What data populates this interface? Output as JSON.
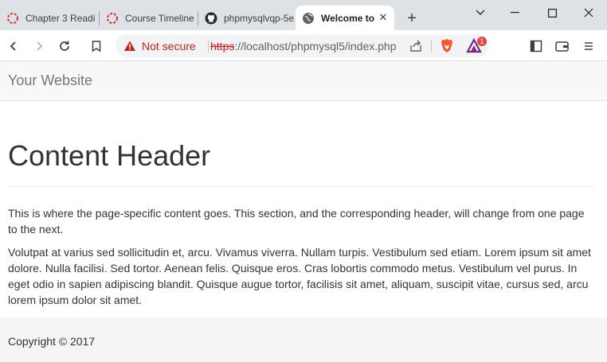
{
  "browser": {
    "tabs": [
      {
        "label": "Chapter 3 Readi",
        "icon": "spinner-icon",
        "active": false
      },
      {
        "label": "Course Timeline",
        "icon": "spinner-icon",
        "active": false
      },
      {
        "label": "phpmysqlvqp-5e",
        "icon": "github-icon",
        "active": false
      },
      {
        "label": "Welcome to",
        "icon": "globe-icon",
        "active": true
      }
    ],
    "new_tab_label": "+",
    "omnibox": {
      "security_label": "Not secure",
      "url_scheme": "https",
      "url_rest": "://localhost/phpmysql5/index.php"
    },
    "rewards_badge": "1"
  },
  "page": {
    "brand": "Your Website",
    "title": "Content Header",
    "paragraphs": [
      "This is where the page-specific content goes. This section, and the corresponding header, will change from one page to the next.",
      "Volutpat at varius sed sollicitudin et, arcu. Vivamus viverra. Nullam turpis. Vestibulum sed etiam. Lorem ipsum sit amet dolore. Nulla facilisi. Sed tortor. Aenean felis. Quisque eros. Cras lobortis commodo metus. Vestibulum vel purus. In eget odio in sapien adipiscing blandit. Quisque augue tortor, facilisis sit amet, aliquam, suscipit vitae, cursus sed, arcu lorem ipsum dolor sit amet."
    ],
    "footer": "Copyright © 2017"
  },
  "colors": {
    "not_secure": "#c5221f",
    "tabstrip": "#dee1e6",
    "navbar": "#f8f8f8",
    "footer": "#f5f5f5"
  }
}
